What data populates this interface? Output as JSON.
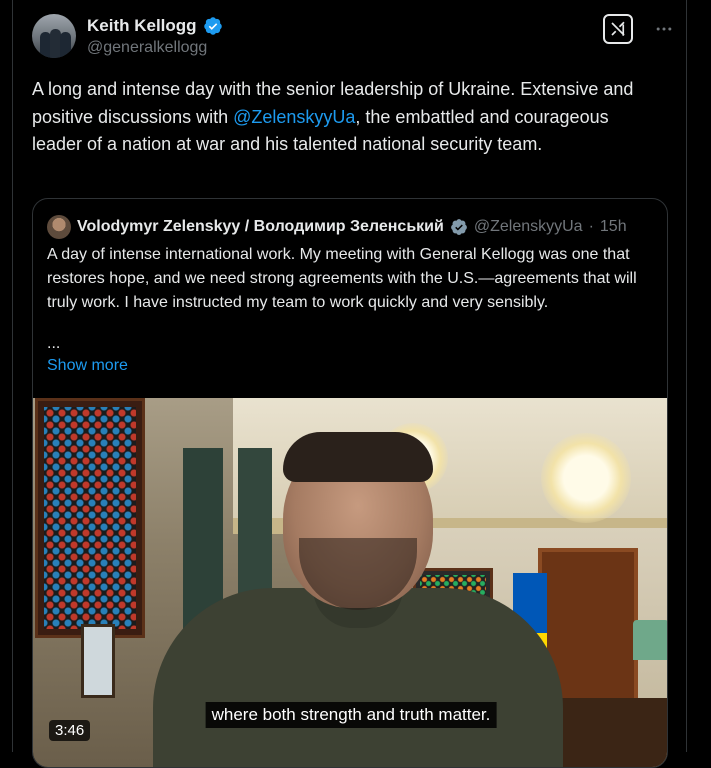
{
  "author": {
    "name": "Keith Kellogg",
    "handle": "@generalkellogg",
    "verified_color": "#1d9bf0"
  },
  "actions": {
    "grok_icon": "xai-grok-icon",
    "more_label": "···"
  },
  "tweet": {
    "text_part1": "A long and intense day with the senior leadership of Ukraine.  Extensive and positive discussions with ",
    "mention": "@ZelenskyyUa",
    "text_part2": ", the embattled and courageous leader of a nation at war and his talented national security team."
  },
  "quoted": {
    "name": "Volodymyr Zelenskyy / Володимир Зеленський",
    "handle": "@ZelenskyyUa",
    "separator": "·",
    "time": "15h",
    "text": "A day of intense international work. My meeting with General Kellogg was one that restores hope, and we need strong agreements with the U.S.—agreements that will truly work. I have instructed my team to work quickly and very sensibly.",
    "ellipsis": "...",
    "show_more": "Show more",
    "video": {
      "caption": "where both strength and truth matter.",
      "duration": "3:46"
    }
  },
  "colors": {
    "background": "#000000",
    "text": "#e7e9ea",
    "secondary": "#71767b",
    "accent": "#1d9bf0",
    "border": "#2f3336"
  }
}
